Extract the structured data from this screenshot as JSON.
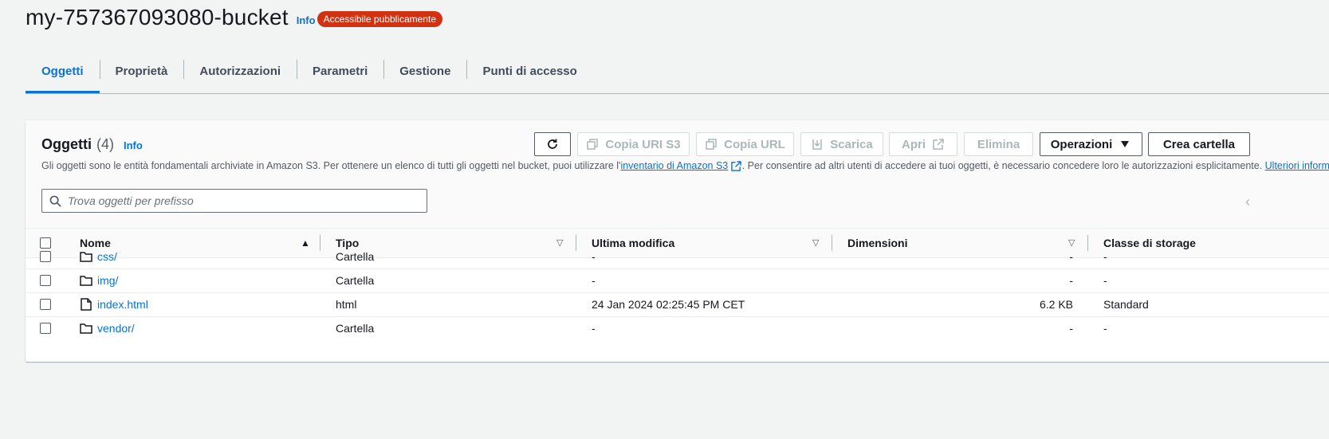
{
  "bucket": {
    "name": "my-757367093080-bucket",
    "info_label": "Info",
    "public_badge": "Accessibile pubblicamente"
  },
  "tabs": [
    {
      "label": "Oggetti",
      "active": true
    },
    {
      "label": "Proprietà"
    },
    {
      "label": "Autorizzazioni"
    },
    {
      "label": "Parametri"
    },
    {
      "label": "Gestione"
    },
    {
      "label": "Punti di accesso"
    }
  ],
  "objects_panel": {
    "title": "Oggetti",
    "count": "(4)",
    "info_label": "Info",
    "buttons": {
      "copy_uri": "Copia URI S3",
      "copy_url": "Copia URL",
      "download": "Scarica",
      "open": "Apri",
      "delete": "Elimina",
      "actions": "Operazioni",
      "create_folder": "Crea cartella"
    },
    "description_before": "Gli oggetti sono le entità fondamentali archiviate in Amazon S3. Per ottenere un elenco di tutti gli oggetti nel bucket, puoi utilizzare l'",
    "description_link": "inventario di Amazon S3",
    "description_after": ". Per consentire ad altri utenti di accedere ai tuoi oggetti, è necessario concedere loro le autorizzazioni esplicitamente. ",
    "description_link2": "Ulteriori informazioni",
    "search_placeholder": "Trova oggetti per prefisso"
  },
  "table": {
    "columns": [
      "Nome",
      "Tipo",
      "Ultima modifica",
      "Dimensioni",
      "Classe di storage"
    ],
    "rows": [
      {
        "name": "css/",
        "type": "Cartella",
        "modified": "-",
        "size": "-",
        "storage": "-",
        "icon": "folder-icon"
      },
      {
        "name": "img/",
        "type": "Cartella",
        "modified": "-",
        "size": "-",
        "storage": "-",
        "icon": "folder-icon"
      },
      {
        "name": "index.html",
        "type": "html",
        "modified": "24 Jan 2024 02:25:45 PM CET",
        "size": "6.2 KB",
        "storage": "Standard",
        "icon": "file-icon"
      },
      {
        "name": "vendor/",
        "type": "Cartella",
        "modified": "-",
        "size": "-",
        "storage": "-",
        "icon": "folder-icon"
      }
    ]
  },
  "colors": {
    "link": "#0972d3",
    "badge_red": "#d13212",
    "border": "#aab7b8"
  }
}
